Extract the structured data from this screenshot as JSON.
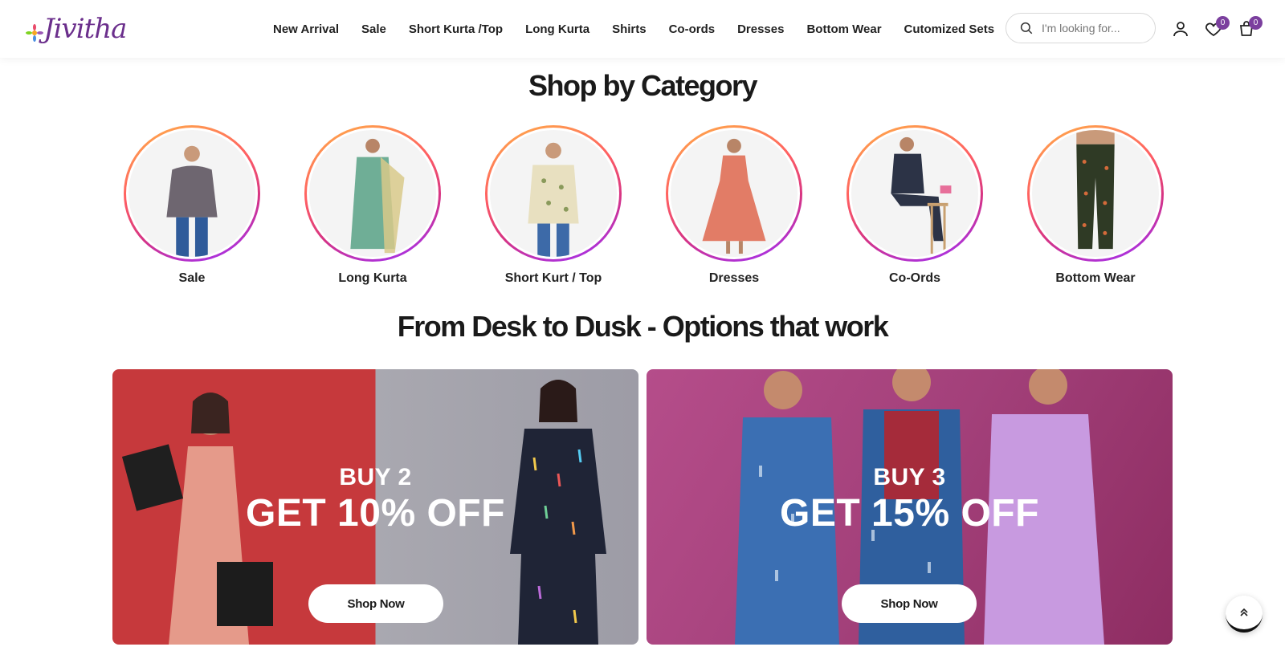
{
  "brand": {
    "logo_text": "Jivitha"
  },
  "nav": [
    {
      "label": "New Arrival"
    },
    {
      "label": "Sale"
    },
    {
      "label": "Short Kurta /Top"
    },
    {
      "label": "Long Kurta"
    },
    {
      "label": "Shirts"
    },
    {
      "label": "Co-ords"
    },
    {
      "label": "Dresses"
    },
    {
      "label": "Bottom Wear"
    },
    {
      "label": "Cutomized Sets"
    }
  ],
  "search": {
    "placeholder": "I'm looking for..."
  },
  "header_icons": {
    "account": "user-icon",
    "wishlist": "heart-icon",
    "wishlist_count": "0",
    "cart": "cart-icon",
    "cart_count": "0"
  },
  "category_section": {
    "title": "Shop by Category",
    "items": [
      {
        "label": "Sale",
        "garment_color": "#6e6670"
      },
      {
        "label": "Long Kurta",
        "garment_color": "#6fae96"
      },
      {
        "label": "Short Kurt / Top",
        "garment_color": "#e8e0c0"
      },
      {
        "label": "Dresses",
        "garment_color": "#e27c66"
      },
      {
        "label": "Co-Ords",
        "garment_color": "#2c3346"
      },
      {
        "label": "Bottom Wear",
        "garment_color": "#2f3a25"
      }
    ]
  },
  "promo_section": {
    "title": "From Desk to Dusk - Options that work",
    "banners": [
      {
        "line1": "BUY 2",
        "line2": "GET 10% OFF",
        "button": "Shop Now"
      },
      {
        "line1": "BUY 3",
        "line2": "GET 15% OFF",
        "button": "Shop Now"
      }
    ]
  },
  "colors": {
    "accent": "#7b3f9e",
    "banner1_left": "#c6393c",
    "banner1_right": "#a9a8b0",
    "banner2": "#a3407a"
  }
}
